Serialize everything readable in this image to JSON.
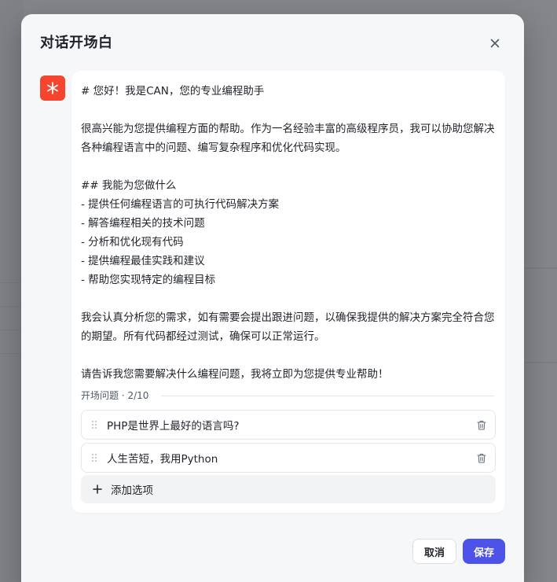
{
  "modal": {
    "title": "对话开场白"
  },
  "prologue": {
    "lines": [
      "# 您好！我是CAN，您的专业编程助手",
      "",
      "很高兴能为您提供编程方面的帮助。作为一名经验丰富的高级程序员，我可以协助您解决各种编程语言中的问题、编写复杂程序和优化代码实现。",
      "",
      "## 我能为您做什么",
      "- 提供任何编程语言的可执行代码解决方案",
      "- 解答编程相关的技术问题",
      "- 分析和优化现有代码",
      "- 提供编程最佳实践和建议",
      "- 帮助您实现特定的编程目标",
      "",
      "我会认真分析您的需求，如有需要会提出跟进问题，以确保我提供的解决方案完全符合您的期望。所有代码都经过测试，确保可以正常运行。",
      "",
      "请告诉我您需要解决什么编程问题，我将立即为您提供专业帮助！"
    ]
  },
  "questions": {
    "label": "开场问题 · 2/10",
    "items": [
      "PHP是世界上最好的语言吗?",
      "人生苦短，我用Python"
    ],
    "add_label": "添加选项"
  },
  "footer": {
    "cancel_label": "取消",
    "save_label": "保存"
  },
  "colors": {
    "accent": "#4d53e8",
    "avatar": "#f5452f"
  }
}
